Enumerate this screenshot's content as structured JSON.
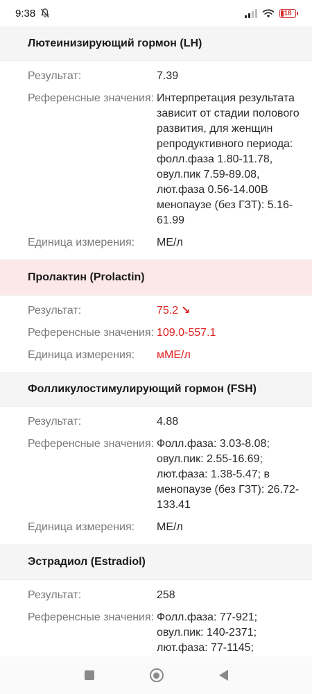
{
  "status_bar": {
    "time": "9:38",
    "battery": "18",
    "icons": [
      "bell-off-icon",
      "signal-icon",
      "wifi-icon",
      "battery-icon"
    ]
  },
  "sections": [
    {
      "title": "Лютеинизирующий гормон (LH)",
      "abnormal": false,
      "rows": [
        {
          "label": "Результат:",
          "value": "7.39"
        },
        {
          "label": "Референсные значения:",
          "value": "Интерпретация результата зависит от стадии полового развития, для женщин репродуктивного периода: фолл.фаза 1.80-11.78, овул.пик 7.59-89.08, лют.фаза 0.56-14.00В менопаузе (без ГЗТ): 5.16-61.99"
        },
        {
          "label": "Единица измерения:",
          "value": "МЕ/л"
        }
      ]
    },
    {
      "title": "Пролактин (Prolactin)",
      "abnormal": true,
      "rows": [
        {
          "label": "Результат:",
          "value": "75.2",
          "flag": "↘"
        },
        {
          "label": "Референсные значения:",
          "value": "109.0-557.1"
        },
        {
          "label": "Единица измерения:",
          "value": "мМЕ/л"
        }
      ]
    },
    {
      "title": "Фолликулостимулирующий гормон (FSH)",
      "abnormal": false,
      "rows": [
        {
          "label": "Результат:",
          "value": "4.88"
        },
        {
          "label": "Референсные значения:",
          "value": "Фолл.фаза: 3.03-8.08; овул.пик: 2.55-16.69; лют.фаза: 1.38-5.47; в менопаузе (без ГЗТ): 26.72-133.41"
        },
        {
          "label": "Единица измерения:",
          "value": "МЕ/л"
        }
      ]
    },
    {
      "title": "Эстрадиол (Estradiol)",
      "abnormal": false,
      "rows": [
        {
          "label": "Результат:",
          "value": "258"
        },
        {
          "label": "Референсные значения:",
          "value": "Фолл.фаза: 77-921; овул.пик: 140-2371; лют.фаза: 77-1145;"
        }
      ]
    }
  ],
  "colors": {
    "abnormal_text": "#e02020",
    "abnormal_header_bg": "#fde8e8",
    "header_bg": "#f5f5f5"
  },
  "nav_bar": {
    "icons": [
      "recents-icon",
      "home-icon",
      "back-icon"
    ]
  }
}
